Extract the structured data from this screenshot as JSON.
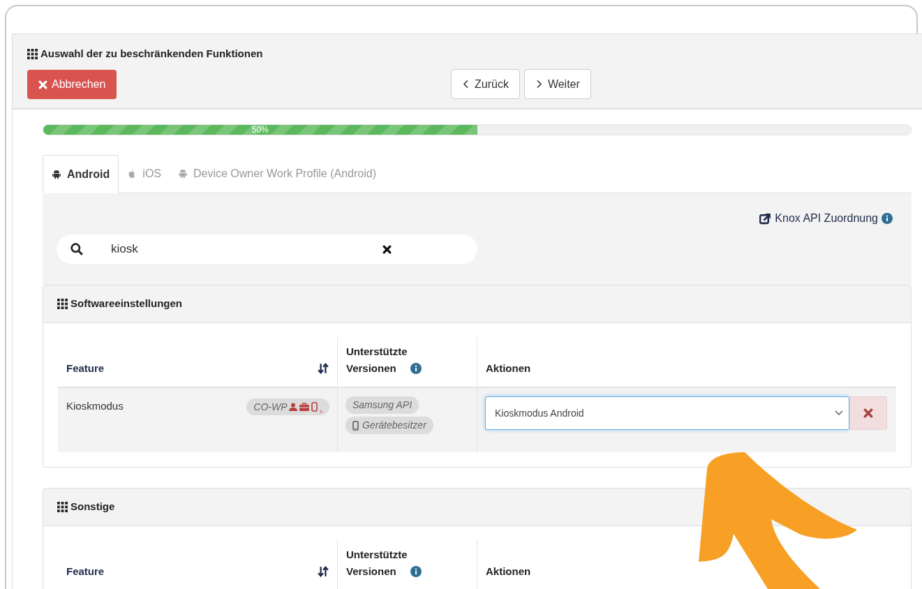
{
  "panel_title": "Auswahl der zu beschränkenden Funktionen",
  "cancel_button": {
    "label": "Abbrechen"
  },
  "nav_buttons": [
    {
      "kind": "back",
      "label": "Zurück"
    },
    {
      "kind": "next",
      "label": "Weiter"
    }
  ],
  "progress": {
    "level": 0.5,
    "label": "50%"
  },
  "tabs": [
    {
      "kind": "android",
      "label": "Android",
      "selected": true
    },
    {
      "kind": "apple",
      "label": "iOS",
      "selected": false
    },
    {
      "kind": "android",
      "label": "Device Owner Work Profile (Android)",
      "selected": false
    }
  ],
  "knox_link": "Knox API Zuordnung",
  "search": {
    "value": "kiosk"
  },
  "sections": [
    {
      "title": "Softwareeinstellungen",
      "columns": [
        "Feature",
        "Unterstützte Versionen",
        "Aktionen"
      ],
      "rows": [
        {
          "feature": "Kioskmodus",
          "badge": "CO-WP",
          "badge_suffix": "s",
          "versions": [
            {
              "kind": "api",
              "label": "Samsung API"
            },
            {
              "kind": "device",
              "label": "Gerätebesitzer"
            }
          ],
          "action": "Kioskmodus Android"
        }
      ]
    },
    {
      "title": "Sonstige",
      "columns": [
        "Feature",
        "Unterstützte Versionen",
        "Aktionen"
      ]
    }
  ]
}
